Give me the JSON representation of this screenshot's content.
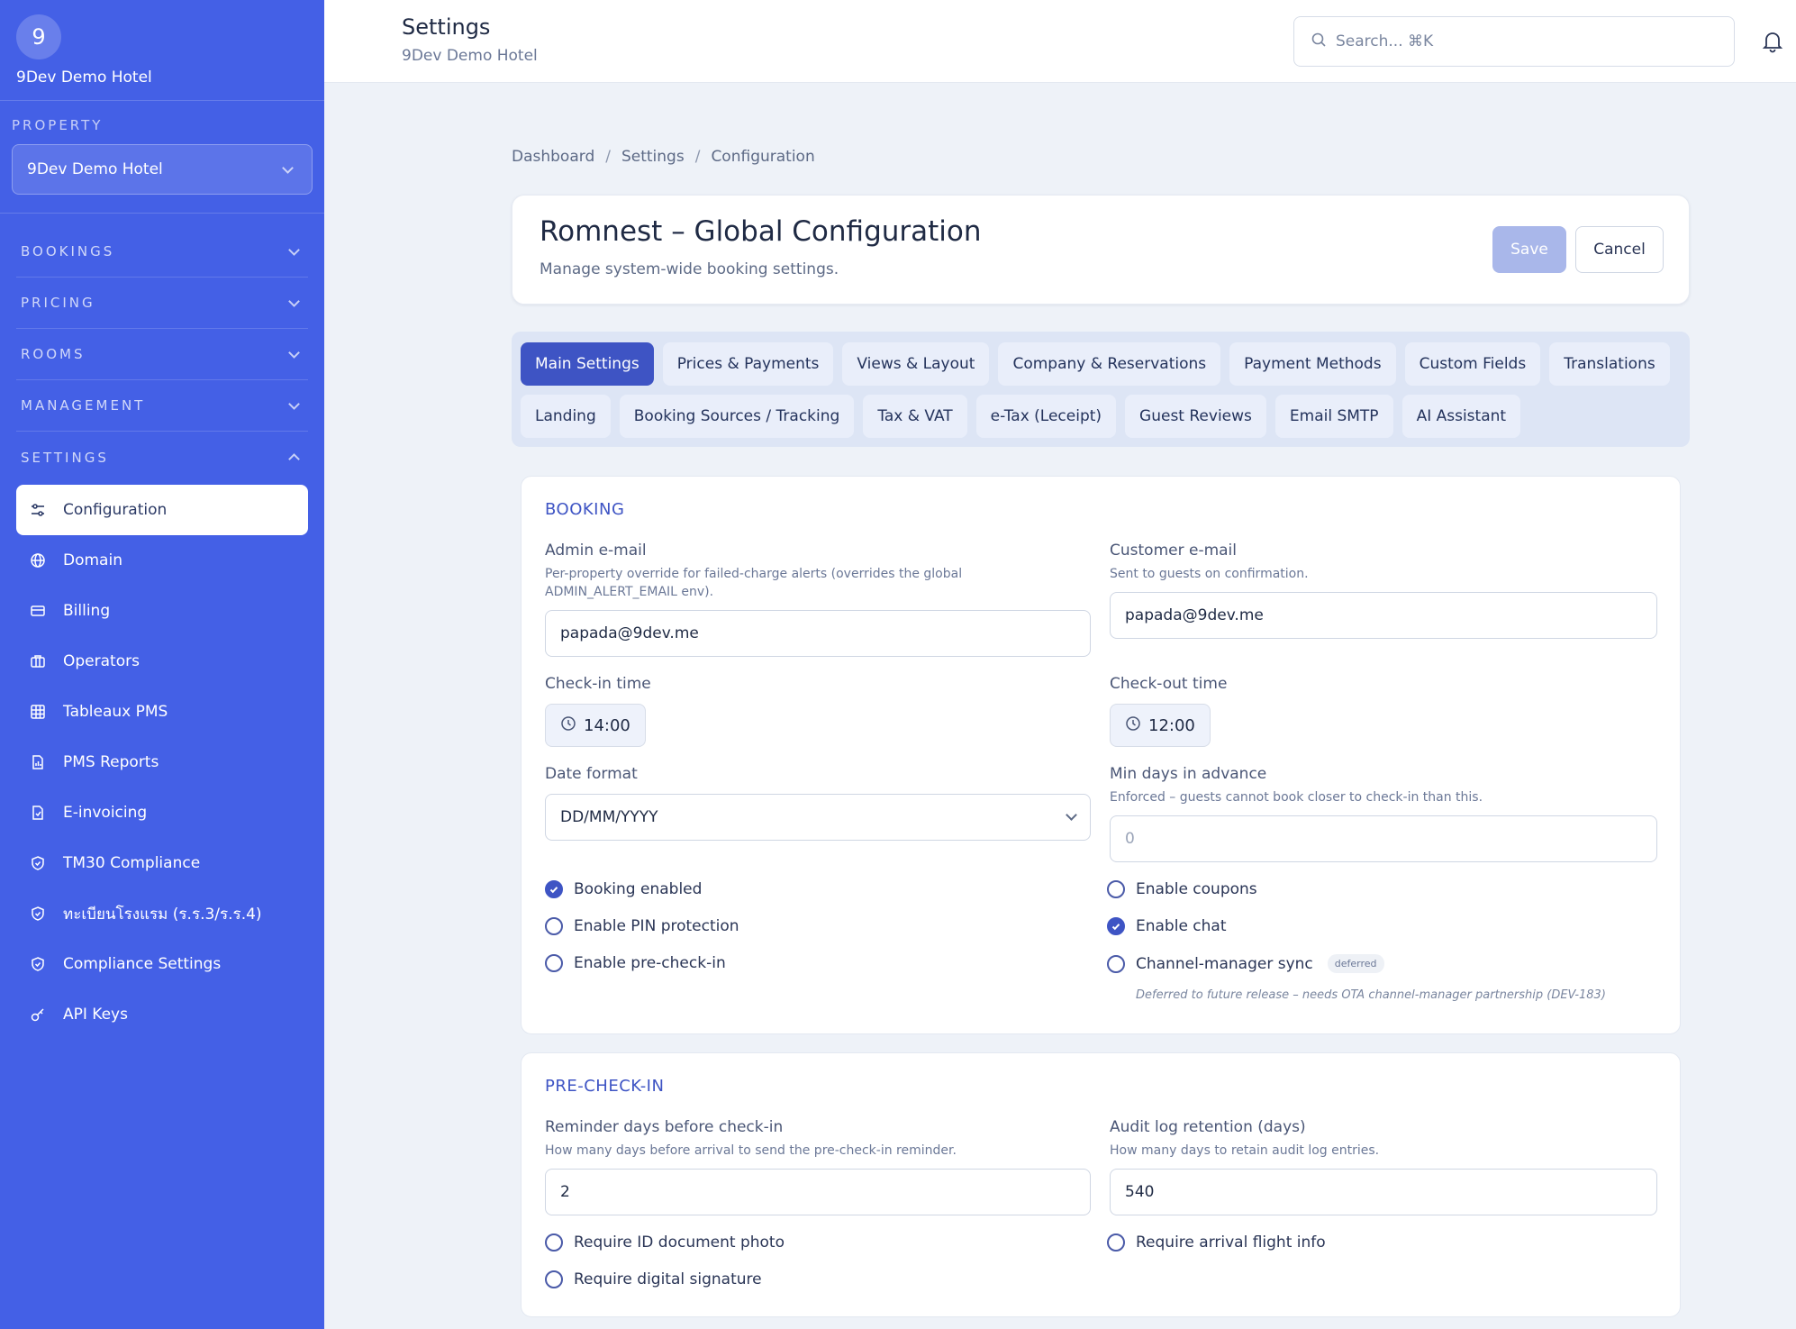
{
  "brand": {
    "initial": "9",
    "name": "9Dev Demo Hotel"
  },
  "property": {
    "caption": "PROPERTY",
    "selected": "9Dev Demo Hotel"
  },
  "nav": {
    "groups": [
      "BOOKINGS",
      "PRICING",
      "ROOMS",
      "MANAGEMENT",
      "SETTINGS"
    ],
    "settings_items": [
      {
        "label": "Configuration",
        "icon": "sliders-icon"
      },
      {
        "label": "Domain",
        "icon": "globe-icon"
      },
      {
        "label": "Billing",
        "icon": "credit-card-icon"
      },
      {
        "label": "Operators",
        "icon": "briefcase-icon"
      },
      {
        "label": "Tableaux PMS",
        "icon": "grid-icon"
      },
      {
        "label": "PMS Reports",
        "icon": "report-icon"
      },
      {
        "label": "E-invoicing",
        "icon": "document-check-icon"
      },
      {
        "label": "TM30 Compliance",
        "icon": "shield-check-icon"
      },
      {
        "label": "ทะเบียนโรงแรม (ร.ร.3/ร.ร.4)",
        "icon": "shield-check-icon"
      },
      {
        "label": "Compliance Settings",
        "icon": "shield-check-icon"
      },
      {
        "label": "API Keys",
        "icon": "key-icon"
      }
    ]
  },
  "topbar": {
    "title": "Settings",
    "subtitle": "9Dev Demo Hotel",
    "search_placeholder": "Search... ⌘K"
  },
  "breadcrumb": [
    "Dashboard",
    "Settings",
    "Configuration"
  ],
  "header": {
    "title": "Romnest – Global Configuration",
    "subtitle": "Manage system-wide booking settings.",
    "save_label": "Save",
    "cancel_label": "Cancel"
  },
  "tabs": [
    "Main Settings",
    "Prices & Payments",
    "Views & Layout",
    "Company & Reservations",
    "Payment Methods",
    "Custom Fields",
    "Translations",
    "Landing",
    "Booking Sources / Tracking",
    "Tax & VAT",
    "e-Tax (Leceipt)",
    "Guest Reviews",
    "Email SMTP",
    "AI Assistant"
  ],
  "booking": {
    "title": "BOOKING",
    "admin_email": {
      "label": "Admin e-mail",
      "help": "Per-property override for failed-charge alerts (overrides the global ADMIN_ALERT_EMAIL env).",
      "value": "papada@9dev.me"
    },
    "customer_email": {
      "label": "Customer e-mail",
      "help": "Sent to guests on confirmation.",
      "value": "papada@9dev.me"
    },
    "checkin": {
      "label": "Check-in time",
      "value": "14:00"
    },
    "checkout": {
      "label": "Check-out time",
      "value": "12:00"
    },
    "date_format": {
      "label": "Date format",
      "value": "DD/MM/YYYY"
    },
    "min_days": {
      "label": "Min days in advance",
      "help": "Enforced – guests cannot book closer to check-in than this.",
      "placeholder": "0"
    },
    "checks_left": [
      {
        "label": "Booking enabled",
        "checked": true
      },
      {
        "label": "Enable PIN protection",
        "checked": false
      },
      {
        "label": "Enable pre-check-in",
        "checked": false
      }
    ],
    "checks_right": [
      {
        "label": "Enable coupons",
        "checked": false
      },
      {
        "label": "Enable chat",
        "checked": true
      },
      {
        "label": "Channel-manager sync",
        "checked": false
      }
    ],
    "deferred_badge": "deferred",
    "deferred_note": "Deferred to future release – needs OTA channel-manager partnership (DEV-183)"
  },
  "precheck": {
    "title": "PRE-CHECK-IN",
    "reminder": {
      "label": "Reminder days before check-in",
      "help": "How many days before arrival to send the pre-check-in reminder.",
      "value": "2"
    },
    "audit": {
      "label": "Audit log retention (days)",
      "help": "How many days to retain audit log entries.",
      "value": "540"
    },
    "checks_left": [
      {
        "label": "Require ID document photo",
        "checked": false
      },
      {
        "label": "Require digital signature",
        "checked": false
      }
    ],
    "checks_right": [
      {
        "label": "Require arrival flight info",
        "checked": false
      }
    ]
  },
  "colors": {
    "sidebar": "#4460e6",
    "accent": "#3e54c4",
    "save_disabled": "#a9b7ea"
  }
}
